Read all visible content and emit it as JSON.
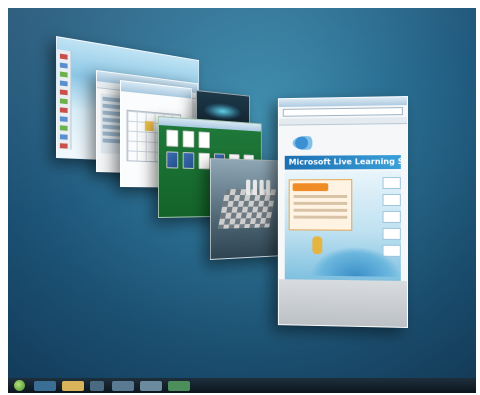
{
  "screen": {
    "description_free": true
  },
  "flip3d": {
    "windows": [
      {
        "id": "window-aero-blank"
      },
      {
        "id": "window-explorer"
      },
      {
        "id": "window-calendar"
      },
      {
        "id": "window-media-center"
      },
      {
        "id": "window-solitaire"
      },
      {
        "id": "window-chess"
      },
      {
        "id": "window-internet-explorer",
        "banner_text": "Microsoft Live Learning Skill"
      }
    ]
  },
  "taskbar": {
    "items": [
      {
        "name": "start-button-icon",
        "color": "#5aa83a"
      },
      {
        "name": "taskbar-item-ie",
        "color": "#3a6e94"
      },
      {
        "name": "taskbar-item-explorer",
        "color": "#d9b45a"
      },
      {
        "name": "taskbar-item-media",
        "color": "#4a6a82"
      },
      {
        "name": "taskbar-item-app4",
        "color": "#5a7a92"
      },
      {
        "name": "taskbar-item-app5",
        "color": "#6b8a9e"
      },
      {
        "name": "taskbar-item-app6",
        "color": "#4d8f5a"
      }
    ]
  },
  "colors": {
    "desktop": "#1d5579",
    "accent": "#3aa0d8",
    "solitaire_felt": "#1f7a3a",
    "panel_orange": "#f08c26"
  }
}
